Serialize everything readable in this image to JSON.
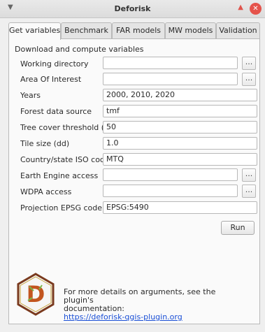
{
  "window": {
    "menu_icon": "chevron-down-icon",
    "title": "Deforisk",
    "keep_above_icon": "triangle-up-icon",
    "close_icon": "close-icon",
    "close_glyph": "✕"
  },
  "tabs": [
    {
      "label": "Get variables",
      "active": true
    },
    {
      "label": "Benchmark",
      "active": false
    },
    {
      "label": "FAR models",
      "active": false
    },
    {
      "label": "MW models",
      "active": false
    },
    {
      "label": "Validation",
      "active": false
    }
  ],
  "section_title": "Download and compute variables",
  "form": [
    {
      "label": "Working directory",
      "value": "",
      "browse": "..."
    },
    {
      "label": "Area Of Interest",
      "value": "",
      "browse": "..."
    },
    {
      "label": "Years",
      "value": "2000, 2010, 2020"
    },
    {
      "label": "Forest data source",
      "value": "tmf"
    },
    {
      "label": "Tree cover threshold (%)",
      "value": "50"
    },
    {
      "label": "Tile size (dd)",
      "value": "1.0"
    },
    {
      "label": "Country/state ISO code",
      "value": "MTQ"
    },
    {
      "label": "Earth Engine access",
      "value": "",
      "browse": "..."
    },
    {
      "label": "WDPA access",
      "value": "",
      "browse": "..."
    },
    {
      "label": "Projection EPSG code",
      "value": "EPSG:5490"
    }
  ],
  "run_label": "Run",
  "info": {
    "logo_icon": "deforisk-logo-icon",
    "logo_letter": "D",
    "line1": "For more details on arguments, see the plugin's",
    "line2": "documentation:",
    "link": "https://deforisk-qgis-plugin.org"
  },
  "colors": {
    "link": "#1a4fd6",
    "close": "#e5534b",
    "panel": "#fafafa"
  }
}
